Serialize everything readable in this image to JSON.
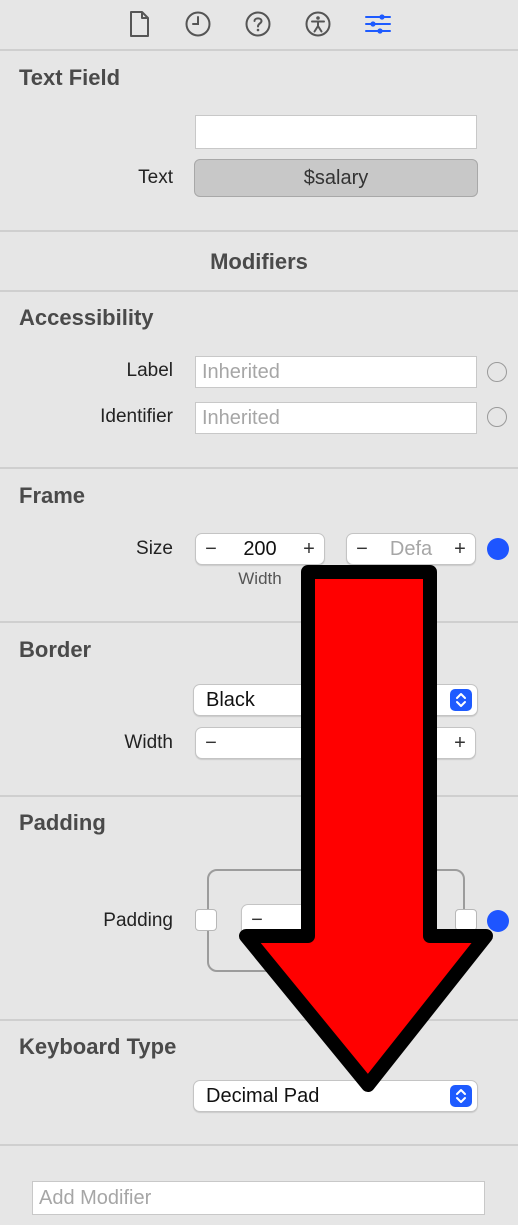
{
  "tabs": [
    {
      "icon": "file-icon"
    },
    {
      "icon": "history-clock-icon"
    },
    {
      "icon": "help-icon"
    },
    {
      "icon": "accessibility-icon"
    },
    {
      "icon": "attributes-sliders-icon",
      "active": true
    }
  ],
  "text_field": {
    "title": "Text Field",
    "field_value": "",
    "text_label": "Text",
    "text_binding": "$salary"
  },
  "modifiers_header": "Modifiers",
  "accessibility": {
    "title": "Accessibility",
    "label_label": "Label",
    "label_placeholder": "Inherited",
    "identifier_label": "Identifier",
    "identifier_placeholder": "Inherited"
  },
  "frame": {
    "title": "Frame",
    "size_label": "Size",
    "width_value": "200",
    "width_caption": "Width",
    "height_placeholder": "Defa",
    "minus": "−",
    "plus": "+"
  },
  "border": {
    "title": "Border",
    "color_value": "Black",
    "width_label": "Width",
    "minus": "−",
    "plus": "+"
  },
  "padding": {
    "title": "Padding",
    "padding_label": "Padding",
    "minus": "−"
  },
  "keyboard_type": {
    "title": "Keyboard Type",
    "value": "Decimal Pad"
  },
  "add_modifier": {
    "placeholder": "Add Modifier"
  },
  "colors": {
    "accent": "#1e55ff",
    "arrow_fill": "#ff0000",
    "arrow_stroke": "#000000"
  }
}
